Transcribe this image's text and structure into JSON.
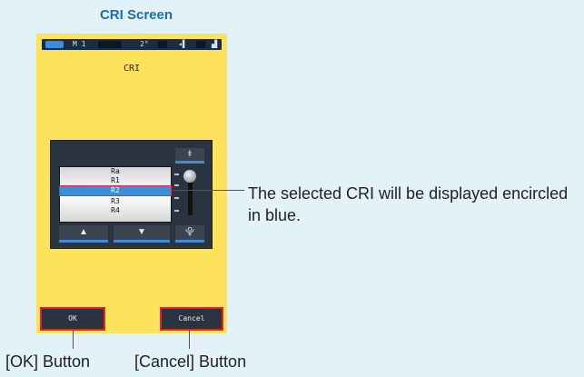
{
  "screen_title": "CRI Screen",
  "status_bar": {
    "memory": "M 1",
    "angle": "2°"
  },
  "device_title": "CRI",
  "cri_list": {
    "items": [
      "Ra",
      "R1",
      "R2",
      "R3",
      "R4"
    ],
    "selected": "R2"
  },
  "scroll_buttons": {
    "top": "⯒",
    "bottom": "⯓",
    "up": "▲",
    "down": "▼"
  },
  "ok_button": "OK",
  "cancel_button": "Cancel",
  "annotations": {
    "callout": "The selected CRI will be displayed encircled in blue.",
    "ok_label": "[OK] Button",
    "cancel_label": "[Cancel] Button"
  },
  "colors": {
    "device_background": "#fde35b",
    "selection": "#3d8ed8",
    "highlight_outline": "#e0252e",
    "title": "#1a6fb8"
  }
}
